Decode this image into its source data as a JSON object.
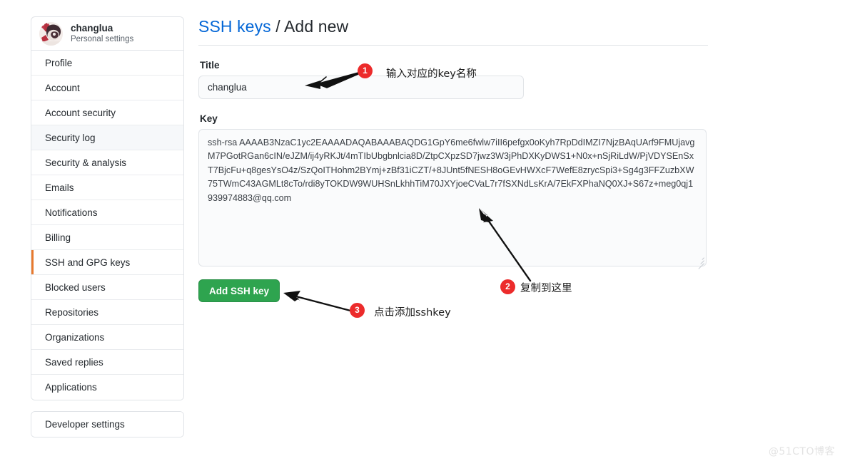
{
  "sidebar": {
    "profile": {
      "name": "changlua",
      "subtitle": "Personal settings",
      "avatar_icon": "user-avatar"
    },
    "items": [
      {
        "label": "Profile",
        "state": "normal"
      },
      {
        "label": "Account",
        "state": "normal"
      },
      {
        "label": "Account security",
        "state": "normal"
      },
      {
        "label": "Security log",
        "state": "hovered"
      },
      {
        "label": "Security & analysis",
        "state": "normal"
      },
      {
        "label": "Emails",
        "state": "normal"
      },
      {
        "label": "Notifications",
        "state": "normal"
      },
      {
        "label": "Billing",
        "state": "normal"
      },
      {
        "label": "SSH and GPG keys",
        "state": "selected"
      },
      {
        "label": "Blocked users",
        "state": "normal"
      },
      {
        "label": "Repositories",
        "state": "normal"
      },
      {
        "label": "Organizations",
        "state": "normal"
      },
      {
        "label": "Saved replies",
        "state": "normal"
      },
      {
        "label": "Applications",
        "state": "normal"
      }
    ],
    "secondary_items": [
      {
        "label": "Developer settings"
      }
    ],
    "selected_accent": "#e36209"
  },
  "header": {
    "breadcrumb_link": "SSH keys",
    "breadcrumb_separator": "/",
    "breadcrumb_current": "Add new",
    "link_color": "#0366d6"
  },
  "form": {
    "title_label": "Title",
    "title_value": "changlua",
    "title_placeholder": "",
    "key_label": "Key",
    "key_value": "ssh-rsa AAAAB3NzaC1yc2EAAAADAQABAAABAQDG1GpY6me6fwlw7iII6pefgx0oKyh7RpDdIMZI7NjzBAqUArf9FMUjavgM7PGotRGan6cIN/eJZM/ij4yRKJt/4mTIbUbgbnlcia8D/ZtpCXpzSD7jwz3W3jPhDXKyDWS1+N0x+nSjRiLdW/PjVDYSEnSxT7BjcFu+q8gesYsO4z/SzQoITHohm2BYmj+zBf31iCZT/+8JUnt5fNESH8oGEvHWXcF7WefE8zrycSpi3+Sg4g3FFZuzbXW75TWmC43AGMLt8cTo/rdi8yTOKDW9WUHSnLkhhTiM70JXYjoeCVaL7r7fSXNdLsKrA/7EkFXPhaNQ0XJ+S67z+meg0qj1 939974883@qq.com",
    "key_placeholder": "",
    "submit_label": "Add SSH key",
    "submit_color": "#2ea44f"
  },
  "annotations": [
    {
      "number": "1",
      "text": "输入对应的key名称"
    },
    {
      "number": "2",
      "text": "复制到这里"
    },
    {
      "number": "3",
      "text": "点击添加sshkey"
    }
  ],
  "watermark": {
    "text": "@51CTO博客"
  }
}
